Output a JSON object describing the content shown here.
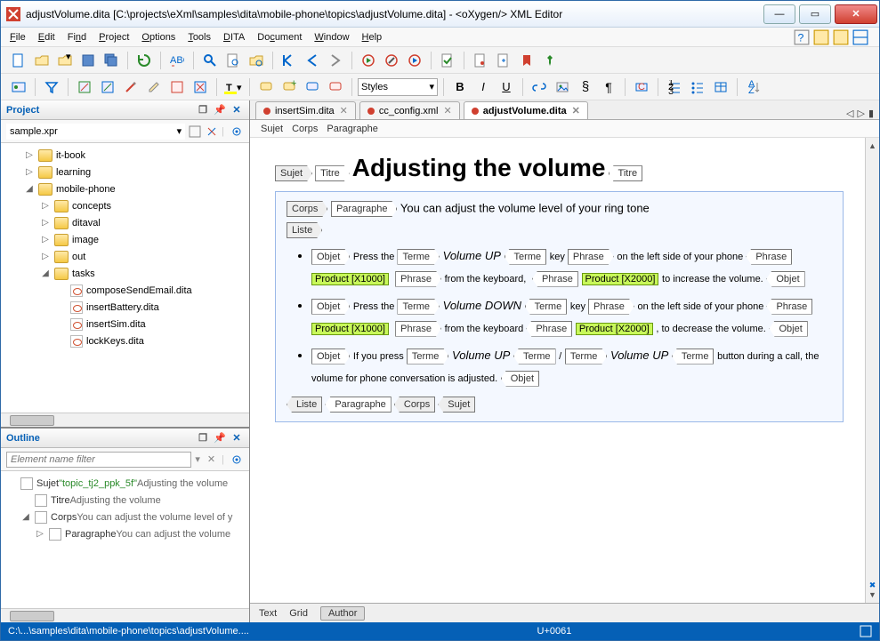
{
  "window": {
    "title": "adjustVolume.dita [C:\\projects\\eXml\\samples\\dita\\mobile-phone\\topics\\adjustVolume.dita] - <oXygen/> XML Editor"
  },
  "menu": {
    "file": "File",
    "edit": "Edit",
    "find": "Find",
    "project": "Project",
    "options": "Options",
    "tools": "Tools",
    "dita": "DITA",
    "document": "Document",
    "window": "Window",
    "help": "Help"
  },
  "styles": {
    "label": "Styles"
  },
  "format": {
    "bold": "B",
    "italic": "I",
    "underline": "U"
  },
  "project": {
    "title": "Project",
    "file": "sample.xpr",
    "tree": [
      {
        "type": "folder",
        "label": "it-book",
        "depth": 1,
        "exp": "▷"
      },
      {
        "type": "folder",
        "label": "learning",
        "depth": 1,
        "exp": "▷"
      },
      {
        "type": "folder",
        "label": "mobile-phone",
        "depth": 1,
        "exp": "◢"
      },
      {
        "type": "folder",
        "label": "concepts",
        "depth": 2,
        "exp": "▷"
      },
      {
        "type": "folder",
        "label": "ditaval",
        "depth": 2,
        "exp": "▷"
      },
      {
        "type": "folder",
        "label": "image",
        "depth": 2,
        "exp": "▷"
      },
      {
        "type": "folder",
        "label": "out",
        "depth": 2,
        "exp": "▷"
      },
      {
        "type": "folder",
        "label": "tasks",
        "depth": 2,
        "exp": "◢"
      },
      {
        "type": "file",
        "label": "composeSendEmail.dita",
        "depth": 3
      },
      {
        "type": "file",
        "label": "insertBattery.dita",
        "depth": 3
      },
      {
        "type": "file",
        "label": "insertSim.dita",
        "depth": 3
      },
      {
        "type": "file",
        "label": "lockKeys.dita",
        "depth": 3
      }
    ]
  },
  "outline": {
    "title": "Outline",
    "placeholder": "Element name filter",
    "items": [
      {
        "icon": "doc",
        "label": "Sujet",
        "extra": "\"topic_tj2_ppk_5f\"",
        "text": "Adjusting the volume",
        "depth": 0,
        "exp": ""
      },
      {
        "icon": "a",
        "label": "Titre",
        "text": "Adjusting the volume",
        "depth": 1,
        "exp": ""
      },
      {
        "icon": "doc",
        "label": "Corps",
        "text": "You can adjust the volume level of y",
        "depth": 1,
        "exp": "◢"
      },
      {
        "icon": "para",
        "label": "Paragraphe",
        "text": "You can adjust the volume",
        "depth": 2,
        "exp": "▷"
      }
    ]
  },
  "tabs": [
    {
      "label": "insertSim.dita",
      "modified": true,
      "active": false
    },
    {
      "label": "cc_config.xml",
      "modified": true,
      "active": false
    },
    {
      "label": "adjustVolume.dita",
      "modified": true,
      "active": true
    }
  ],
  "breadcrumb": [
    "Sujet",
    "Corps",
    "Paragraphe"
  ],
  "doc": {
    "tags": {
      "sujet": "Sujet",
      "titre": "Titre",
      "corps": "Corps",
      "paragraphe": "Paragraphe",
      "liste": "Liste",
      "objet": "Objet",
      "terme": "Terme",
      "phrase": "Phrase"
    },
    "title": "Adjusting the volume",
    "intro": "You can adjust the volume level of your ring tone",
    "product1": "Product [X1000]",
    "product2": "Product [X2000]",
    "product2b": "Product [X2000]",
    "li1": {
      "a": "Press the ",
      "term1": "Volume UP",
      "b": " key ",
      "c": "on the left side of your phone ",
      "d": "from the keyboard, ",
      "e": "to increase the volume."
    },
    "li2": {
      "a": "Press the ",
      "term1": "Volume DOWN",
      "b": " key ",
      "c": "on the left side of your phone ",
      "d": "from the keyboard ",
      "e": ", to decrease the volume."
    },
    "li3": {
      "a": "If you press ",
      "term1": "Volume UP",
      "sep": "/",
      "term2": "Volume UP",
      "b": " button during a call, the volume for phone conversation is adjusted."
    }
  },
  "bottomTabs": {
    "text": "Text",
    "grid": "Grid",
    "author": "Author"
  },
  "status": {
    "path": "C:\\...\\samples\\dita\\mobile-phone\\topics\\adjustVolume....",
    "code": "U+0061"
  }
}
